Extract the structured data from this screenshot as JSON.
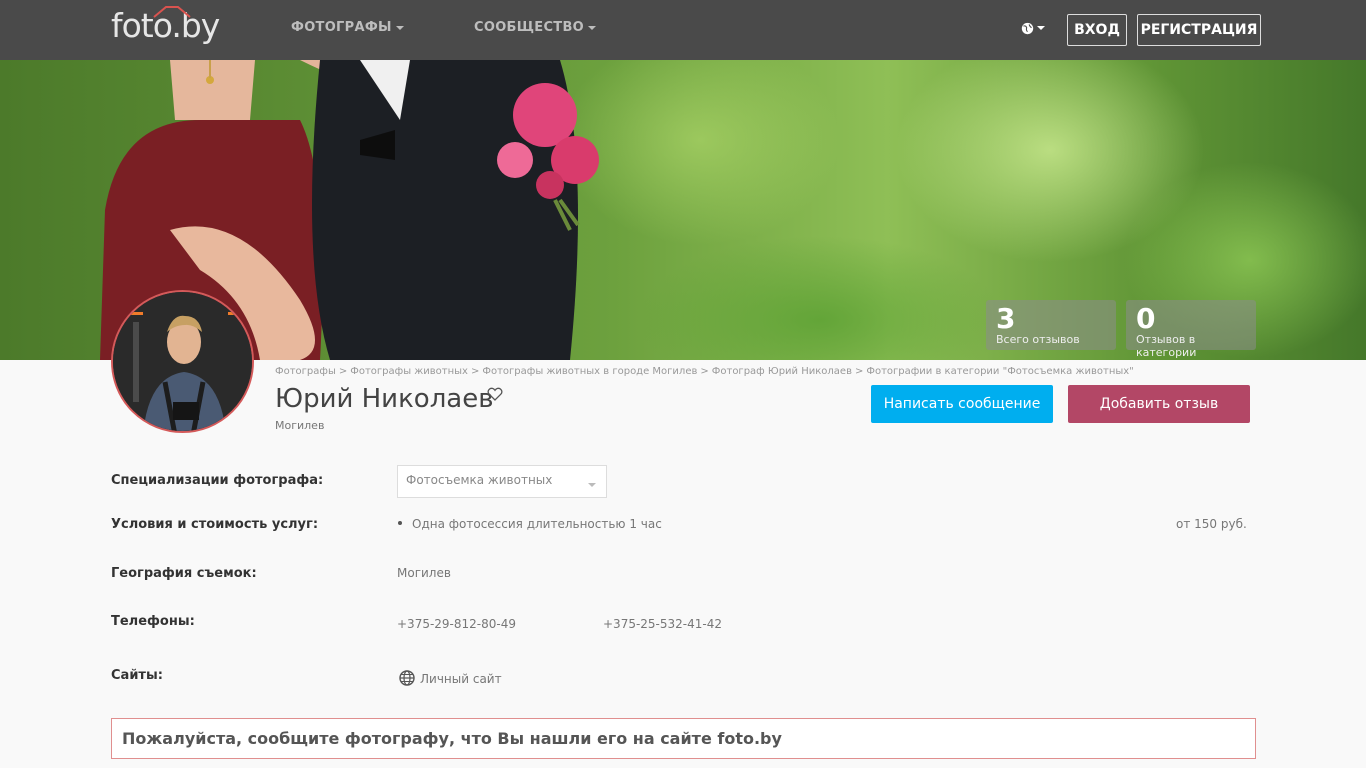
{
  "header": {
    "logo": "foto.by",
    "nav": [
      {
        "label": "ФОТОГРАФЫ"
      },
      {
        "label": "СООБЩЕСТВО"
      }
    ],
    "lang_icon": "globe-icon",
    "login": "ВХОД",
    "register": "РЕГИСТРАЦИЯ"
  },
  "stats": [
    {
      "value": "3",
      "label": "Всего отзывов"
    },
    {
      "value": "0",
      "label": "Отзывов в категории"
    }
  ],
  "breadcrumbs": [
    "Фотографы",
    "Фотографы животных",
    "Фотографы животных в городе Могилев",
    "Фотограф Юрий Николаев",
    "Фотографии в категории \"Фотосъемка животных\""
  ],
  "breadcrumb_separator": ">",
  "profile": {
    "name": "Юрий Николаев",
    "city": "Могилев",
    "message_button": "Написать сообщение",
    "review_button": "Добавить отзыв"
  },
  "info": {
    "specializations_label": "Специализации фотографа:",
    "specialization_selected": "Фотосъемка животных",
    "conditions_label": "Условия и стоимость услуг:",
    "condition_item": "Одна фотосессия длительностью 1 час",
    "condition_price": "от 150 руб.",
    "geography_label": "География съемок:",
    "geography_value": "Могилев",
    "phones_label": "Телефоны:",
    "phones": [
      "+375-29-812-80-49",
      "+375-25-532-41-42"
    ],
    "sites_label": "Сайты:",
    "site_link": "Личный сайт"
  },
  "notice": "Пожалуйста, сообщите фотографу, что Вы нашли его на сайте foto.by",
  "colors": {
    "header_bg": "#4a4a4a",
    "message_button": "#00aeef",
    "review_button": "#b34766",
    "notice_border": "#e08f8f"
  }
}
